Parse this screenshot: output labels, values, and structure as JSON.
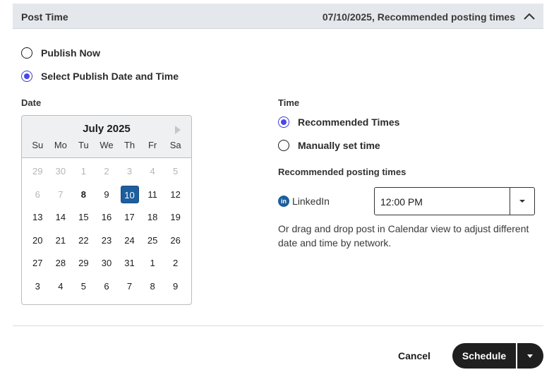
{
  "header": {
    "title": "Post Time",
    "summary": "07/10/2025, Recommended posting times",
    "toggle_icon": "chevron-up-icon"
  },
  "publish_options": [
    {
      "label": "Publish Now",
      "checked": false
    },
    {
      "label": "Select Publish Date and Time",
      "checked": true
    }
  ],
  "date": {
    "label": "Date",
    "month_label": "July 2025",
    "next_icon": "chevron-right-icon",
    "weekdays": [
      "Su",
      "Mo",
      "Tu",
      "We",
      "Th",
      "Fr",
      "Sa"
    ],
    "weeks": [
      [
        "29",
        "30",
        "1",
        "2",
        "3",
        "4",
        "5"
      ],
      [
        "6",
        "7",
        "8",
        "9",
        "10",
        "11",
        "12"
      ],
      [
        "13",
        "14",
        "15",
        "16",
        "17",
        "18",
        "19"
      ],
      [
        "20",
        "21",
        "22",
        "23",
        "24",
        "25",
        "26"
      ],
      [
        "27",
        "28",
        "29",
        "30",
        "31",
        "1",
        "2"
      ],
      [
        "3",
        "4",
        "5",
        "6",
        "7",
        "8",
        "9"
      ]
    ],
    "muted_cells": [
      "0-0",
      "0-1",
      "0-2",
      "0-3",
      "0-4",
      "0-5",
      "0-6",
      "1-0",
      "1-1"
    ],
    "today_cell": "1-2",
    "selected_cell": "1-4"
  },
  "time": {
    "label": "Time",
    "options": [
      {
        "label": "Recommended Times",
        "checked": true
      },
      {
        "label": "Manually set time",
        "checked": false
      }
    ],
    "recommended_heading": "Recommended posting times",
    "network": {
      "icon_text": "in",
      "icon_color": "#1d5e9e",
      "name": "LinkedIn",
      "time_value": "12:00 PM"
    },
    "hint": "Or drag and drop post in Calendar view to adjust different date and time by network."
  },
  "footer": {
    "cancel_label": "Cancel",
    "schedule_label": "Schedule"
  },
  "colors": {
    "accent": "#4a47e8",
    "selected_date": "#1d5e9e",
    "primary_button": "#1f1f1f"
  }
}
